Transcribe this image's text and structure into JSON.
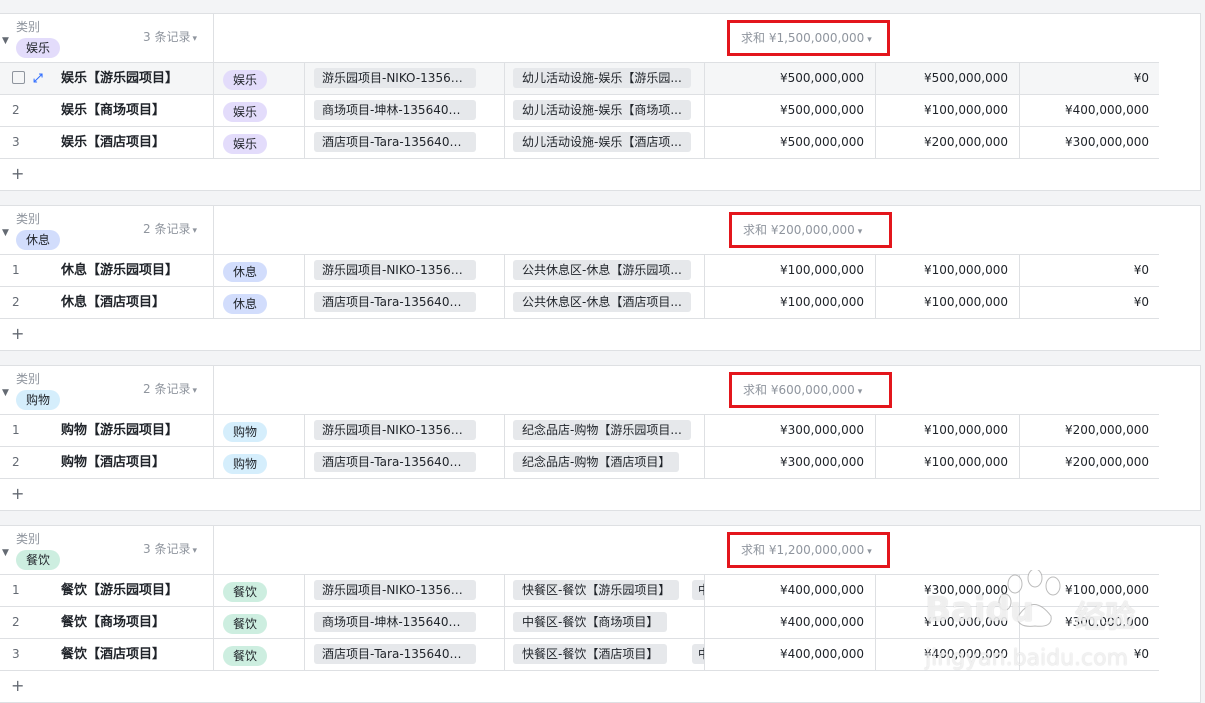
{
  "colors": {
    "entertainment_tag": "#e3dcfb",
    "rest_tag": "#d2ddfc",
    "shopping_tag": "#d5eefc",
    "dining_tag": "#cdeee0",
    "highlight_box": "#e3161c"
  },
  "groups": [
    {
      "field_label": "类别",
      "tag": "娱乐",
      "tag_color": "#e3dcfb",
      "record_count": "3 条记录",
      "sum": "求和 ¥1,500,000,000",
      "rows": [
        {
          "idx": "",
          "name": "娱乐【游乐园项目】",
          "cat": "娱乐",
          "project": "游乐园项目-NIKO-135640...",
          "facility": "幼儿活动设施-娱乐【游乐园...",
          "extra": "",
          "v1": "¥500,000,000",
          "v2": "¥500,000,000",
          "v3": "¥0"
        },
        {
          "idx": "2",
          "name": "娱乐【商场项目】",
          "cat": "娱乐",
          "project": "商场项目-坤林-13564011...",
          "facility": "幼儿活动设施-娱乐【商场项...",
          "extra": "",
          "v1": "¥500,000,000",
          "v2": "¥100,000,000",
          "v3": "¥400,000,000"
        },
        {
          "idx": "3",
          "name": "娱乐【酒店项目】",
          "cat": "娱乐",
          "project": "酒店项目-Tara-135640115...",
          "facility": "幼儿活动设施-娱乐【酒店项...",
          "extra": "",
          "v1": "¥500,000,000",
          "v2": "¥200,000,000",
          "v3": "¥300,000,000"
        }
      ]
    },
    {
      "field_label": "类别",
      "tag": "休息",
      "tag_color": "#d2ddfc",
      "record_count": "2 条记录",
      "sum": "求和 ¥200,000,000",
      "rows": [
        {
          "idx": "1",
          "name": "休息【游乐园项目】",
          "cat": "休息",
          "project": "游乐园项目-NIKO-135640...",
          "facility": "公共休息区-休息【游乐园项...",
          "extra": "",
          "v1": "¥100,000,000",
          "v2": "¥100,000,000",
          "v3": "¥0"
        },
        {
          "idx": "2",
          "name": "休息【酒店项目】",
          "cat": "休息",
          "project": "酒店项目-Tara-135640115...",
          "facility": "公共休息区-休息【酒店项目...",
          "extra": "",
          "v1": "¥100,000,000",
          "v2": "¥100,000,000",
          "v3": "¥0"
        }
      ]
    },
    {
      "field_label": "类别",
      "tag": "购物",
      "tag_color": "#d5eefc",
      "record_count": "2 条记录",
      "sum": "求和 ¥600,000,000",
      "rows": [
        {
          "idx": "1",
          "name": "购物【游乐园项目】",
          "cat": "购物",
          "project": "游乐园项目-NIKO-135640...",
          "facility": "纪念品店-购物【游乐园项目...",
          "extra": "",
          "v1": "¥300,000,000",
          "v2": "¥100,000,000",
          "v3": "¥200,000,000"
        },
        {
          "idx": "2",
          "name": "购物【酒店项目】",
          "cat": "购物",
          "project": "酒店项目-Tara-135640115...",
          "facility": "纪念品店-购物【酒店项目】",
          "extra": "",
          "v1": "¥300,000,000",
          "v2": "¥100,000,000",
          "v3": "¥200,000,000"
        }
      ]
    },
    {
      "field_label": "类别",
      "tag": "餐饮",
      "tag_color": "#cdeee0",
      "record_count": "3 条记录",
      "sum": "求和 ¥1,200,000,000",
      "rows": [
        {
          "idx": "1",
          "name": "餐饮【游乐园项目】",
          "cat": "餐饮",
          "project": "游乐园项目-NIKO-135640...",
          "facility": "快餐区-餐饮【游乐园项目】",
          "extra": "中",
          "v1": "¥400,000,000",
          "v2": "¥300,000,000",
          "v3": "¥100,000,000"
        },
        {
          "idx": "2",
          "name": "餐饮【商场项目】",
          "cat": "餐饮",
          "project": "商场项目-坤林-13564011...",
          "facility": "中餐区-餐饮【商场项目】",
          "extra": "",
          "v1": "¥400,000,000",
          "v2": "¥100,000,000",
          "v3": "¥300,000,000"
        },
        {
          "idx": "3",
          "name": "餐饮【酒店项目】",
          "cat": "餐饮",
          "project": "酒店项目-Tara-135640115...",
          "facility": "快餐区-餐饮【酒店项目】",
          "extra": "中餐",
          "v1": "¥400,000,000",
          "v2": "¥400,000,000",
          "v3": "¥0"
        }
      ]
    }
  ],
  "add_row_label": "+",
  "dropdown_glyph": "▾",
  "expand_glyph": "⤢",
  "watermark": {
    "brand": "Baidu",
    "brand_cn": "经验",
    "url": "jingyan.baidu.com"
  }
}
